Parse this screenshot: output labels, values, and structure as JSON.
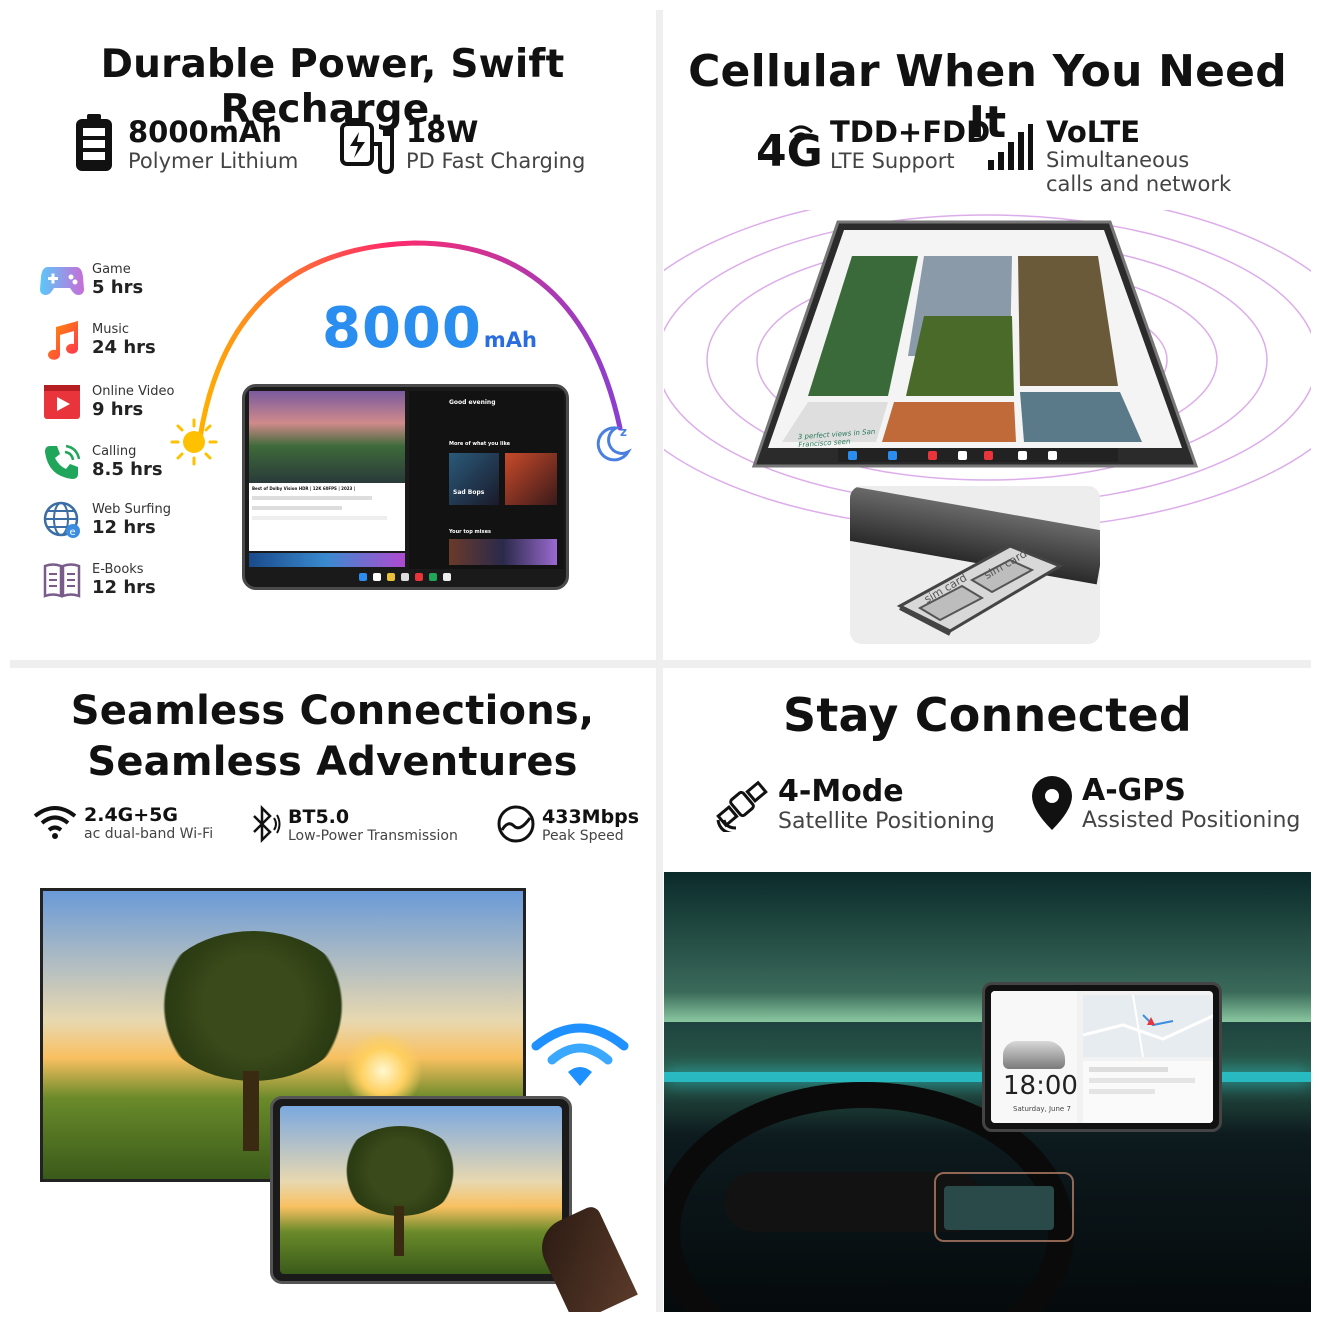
{
  "q1": {
    "title": "Durable Power, Swift Recharge.",
    "battery": {
      "value": "8000mAh",
      "desc": "Polymer Lithium",
      "icon": "battery-icon"
    },
    "charging": {
      "value": "18W",
      "desc": "PD Fast Charging",
      "icon": "charging-icon"
    },
    "capacity_number": "8000",
    "capacity_unit": "mAh",
    "usage": [
      {
        "label": "Game",
        "hours": "5 hrs",
        "icon": "game-controller-icon"
      },
      {
        "label": "Music",
        "hours": "24 hrs",
        "icon": "music-note-icon"
      },
      {
        "label": "Online Video",
        "hours": "9 hrs",
        "icon": "video-play-icon"
      },
      {
        "label": "Calling",
        "hours": "8.5 hrs",
        "icon": "phone-icon"
      },
      {
        "label": "Web Surfing",
        "hours": "12 hrs",
        "icon": "globe-icon"
      },
      {
        "label": "E-Books",
        "hours": "12 hrs",
        "icon": "book-icon"
      }
    ],
    "screen": {
      "video_title": "Best of Dolby Vision HDR | 12K 60FPS | 2023 |",
      "greeting": "Good evening",
      "section_more": "More of what you like",
      "playlist": "Sad Bops",
      "section_top": "Your top mixes"
    }
  },
  "q2": {
    "title": "Cellular When You Need It",
    "lte": {
      "value": "TDD+FDD",
      "desc": "LTE Support",
      "badge": "4G",
      "icon": "4g-signal-icon"
    },
    "volte": {
      "value": "VoLTE",
      "desc": "Simultaneous calls and network",
      "icon": "signal-bars-icon"
    },
    "photo_caption": "3 perfect views in San Francisco seen",
    "sim_label_1": "sim card",
    "sim_label_2": "sim card"
  },
  "q3": {
    "title_line1": "Seamless Connections,",
    "title_line2": "Seamless Adventures",
    "wifi": {
      "value": "2.4G+5G",
      "desc": "ac dual-band Wi-Fi",
      "icon": "wifi-icon"
    },
    "bt": {
      "value": "BT5.0",
      "desc": "Low-Power Transmission",
      "icon": "bluetooth-icon"
    },
    "speed": {
      "value": "433Mbps",
      "desc": "Peak Speed",
      "icon": "speedometer-icon"
    }
  },
  "q4": {
    "title": "Stay Connected",
    "satellite": {
      "value": "4-Mode",
      "desc": "Satellite Positioning",
      "icon": "satellite-icon"
    },
    "agps": {
      "value": "A-GPS",
      "desc": "Assisted Positioning",
      "icon": "location-pin-icon"
    },
    "clock": "18:00",
    "date": "Saturday, June 7"
  },
  "colors": {
    "accent_blue": "#2a8df0",
    "arc_start": "#ffb000",
    "arc_end": "#8a3fd0",
    "wifi_blue": "#1e90ff",
    "dash_cyan": "#29d4e0"
  }
}
